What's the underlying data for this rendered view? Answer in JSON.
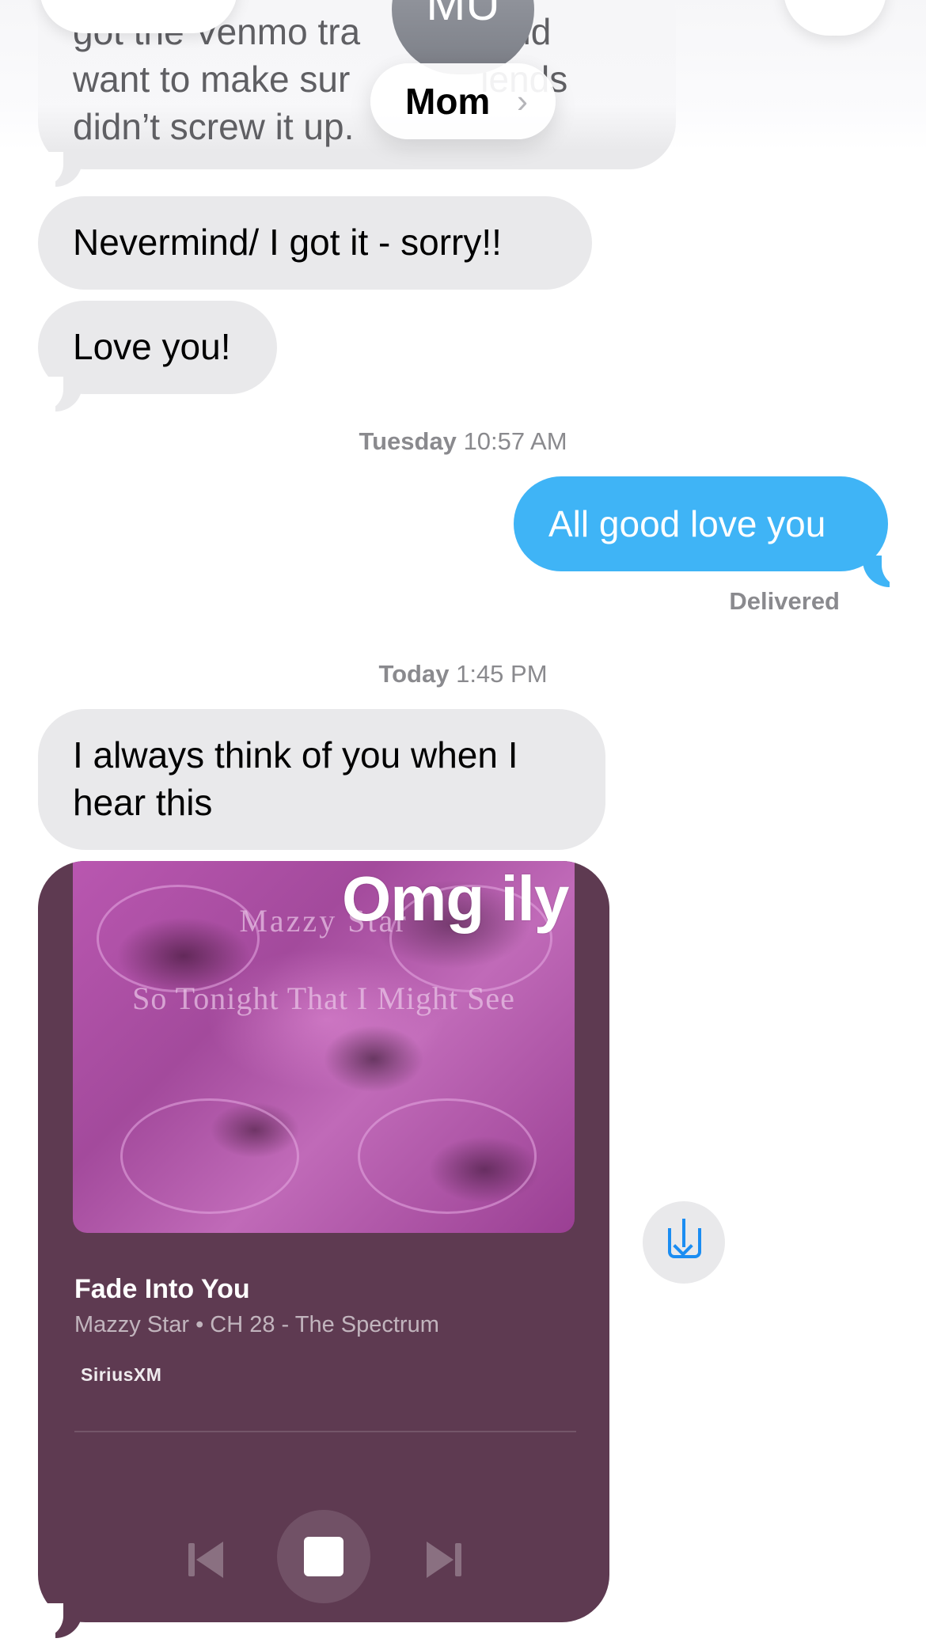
{
  "header": {
    "avatar_initials": "MU",
    "contact_name": "Mom",
    "contact_chevron": "›"
  },
  "messages": {
    "top_partial_line1": "got the Venmo tra",
    "top_partial_line1b": "nd",
    "top_partial_line2": "want to make sur",
    "top_partial_line2b": "iends",
    "top_partial_line3": "didn’t screw it up.",
    "msg_nevermind": "Nevermind/ I got it - sorry!!",
    "msg_love": "Love you!",
    "ts_tuesday_day": "Tuesday",
    "ts_tuesday_time": "10:57 AM",
    "msg_all_good": "All good love you",
    "delivered": "Delivered",
    "ts_today_day": "Today",
    "ts_today_time": "1:45 PM",
    "msg_think_line1": "I always think of you when I",
    "msg_think_line2": "hear this"
  },
  "music_card": {
    "art_artist": "Mazzy Star",
    "art_album": "So Tonight That I Might See",
    "reaction": "Omg ily",
    "song_title": "Fade Into You",
    "song_subtitle": "Mazzy Star • CH 28 - The Spectrum",
    "brand": "SiriusXM",
    "colors": {
      "card_bg": "#5e3a51",
      "art": "#b957b0"
    }
  },
  "icons": {
    "back": "chevron-left-icon",
    "video": "video-camera-icon",
    "prev": "skip-back-icon",
    "stop": "stop-icon",
    "next": "skip-forward-icon",
    "save": "save-to-library-icon"
  },
  "colors": {
    "incoming_bubble": "#e9e9eb",
    "outgoing_bubble": "#3fb4f6",
    "accent_blue": "#1b8df2",
    "meta_gray": "#8a8a8e"
  }
}
